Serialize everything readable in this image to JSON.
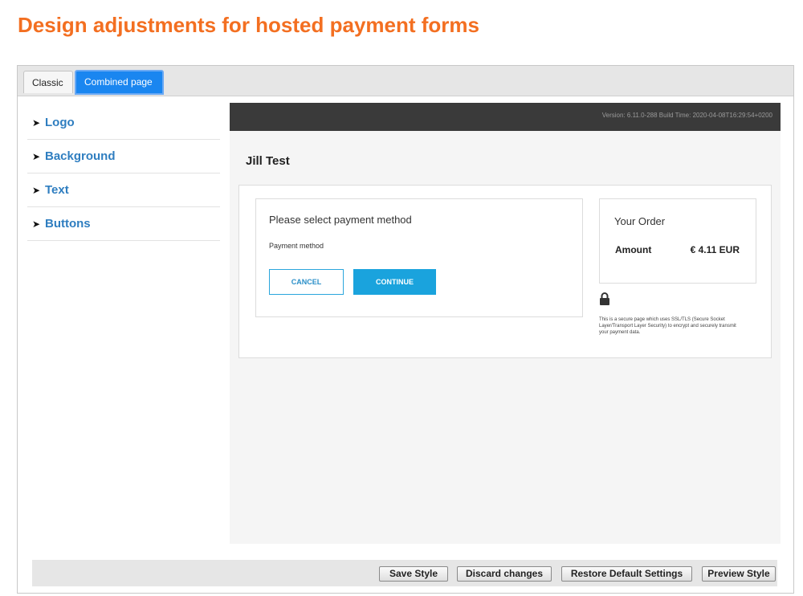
{
  "page": {
    "title": "Design adjustments for hosted payment forms"
  },
  "tabs": [
    {
      "label": "Classic",
      "active": false
    },
    {
      "label": "Combined page",
      "active": true
    }
  ],
  "sidebar": {
    "arrow": "➤",
    "items": [
      {
        "label": "Logo"
      },
      {
        "label": "Background"
      },
      {
        "label": "Text"
      },
      {
        "label": "Buttons"
      }
    ]
  },
  "preview": {
    "version_text": "Version: 6.11.0-288 Build Time: 2020-04-08T16:29:54+0200",
    "customer_name": "Jill Test",
    "payment": {
      "title": "Please select payment method",
      "label": "Payment method",
      "cancel_label": "CANCEL",
      "continue_label": "CONTINUE"
    },
    "order": {
      "title": "Your Order",
      "amount_label": "Amount",
      "amount_value": "€ 4.11 EUR"
    },
    "secure_text": "This is a secure page which uses SSL/TLS (Secure Socket Layer/Transport Layer Security) to encrypt and securely transmit your payment data.",
    "lock_icon": "lock-icon"
  },
  "footer": {
    "save_label": "Save Style",
    "discard_label": "Discard changes",
    "restore_label": "Restore Default Settings",
    "preview_label": "Preview Style"
  },
  "colors": {
    "title": "#f36f21",
    "active_tab": "#1a86f0",
    "sidebar_link": "#2f7ec0",
    "primary_button": "#1aa3dd"
  }
}
